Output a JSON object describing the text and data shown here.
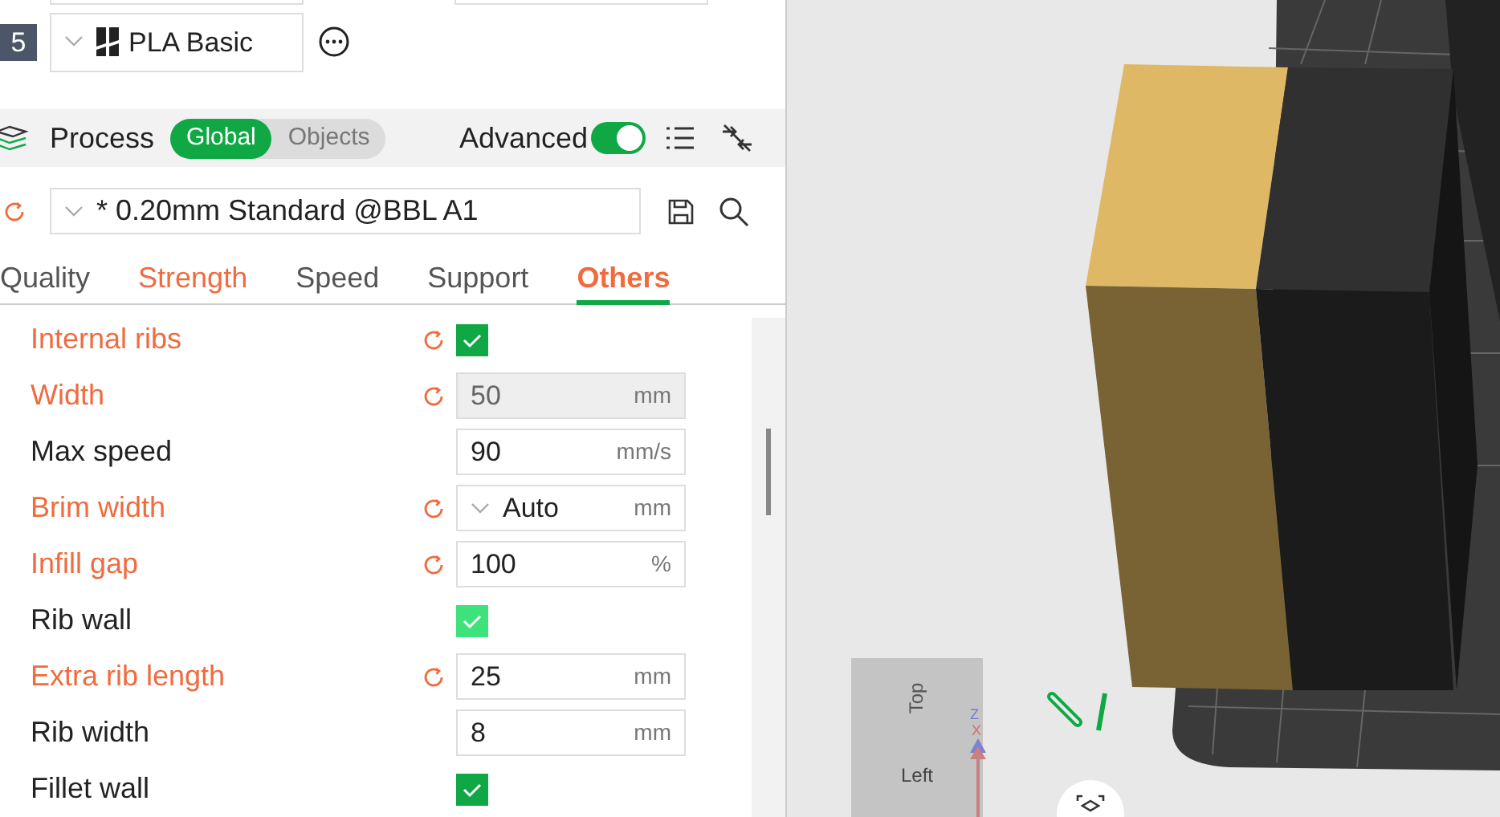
{
  "filament": {
    "index": "5",
    "name": "PLA Basic"
  },
  "process": {
    "title": "Process",
    "scope_tabs": [
      {
        "label": "Global",
        "selected": true
      },
      {
        "label": "Objects",
        "selected": false
      }
    ],
    "advanced": {
      "label": "Advanced",
      "on": true
    },
    "preset": "* 0.20mm Standard @BBL A1",
    "tabs": [
      {
        "label": "Quality",
        "selected": false,
        "modified": false
      },
      {
        "label": "Strength",
        "selected": false,
        "modified": true
      },
      {
        "label": "Speed",
        "selected": false,
        "modified": false
      },
      {
        "label": "Support",
        "selected": false,
        "modified": false
      },
      {
        "label": "Others",
        "selected": true,
        "modified": true
      }
    ],
    "options": [
      {
        "kind": "checkbox",
        "label": "Internal ribs",
        "modified": true,
        "checked": true,
        "disabled": false
      },
      {
        "kind": "input",
        "label": "Width",
        "modified": true,
        "value": "50",
        "unit": "mm",
        "disabled": true
      },
      {
        "kind": "input",
        "label": "Max speed",
        "modified": false,
        "value": "90",
        "unit": "mm/s",
        "disabled": false
      },
      {
        "kind": "dropdown",
        "label": "Brim width",
        "modified": true,
        "value": "Auto",
        "unit": "mm",
        "disabled": false
      },
      {
        "kind": "input",
        "label": "Infill gap",
        "modified": true,
        "value": "100",
        "unit": "%",
        "disabled": false
      },
      {
        "kind": "checkbox",
        "label": "Rib wall",
        "modified": false,
        "checked": true,
        "disabled": true
      },
      {
        "kind": "input",
        "label": "Extra rib length",
        "modified": true,
        "value": "25",
        "unit": "mm",
        "disabled": false
      },
      {
        "kind": "input",
        "label": "Rib width",
        "modified": false,
        "value": "8",
        "unit": "mm",
        "disabled": false
      },
      {
        "kind": "checkbox",
        "label": "Fillet wall",
        "modified": false,
        "checked": true,
        "disabled": false
      }
    ]
  },
  "viewport": {
    "view_cube": {
      "top": "Top",
      "left": "Left"
    },
    "axes": {
      "z": "Z",
      "x": "X"
    }
  }
}
